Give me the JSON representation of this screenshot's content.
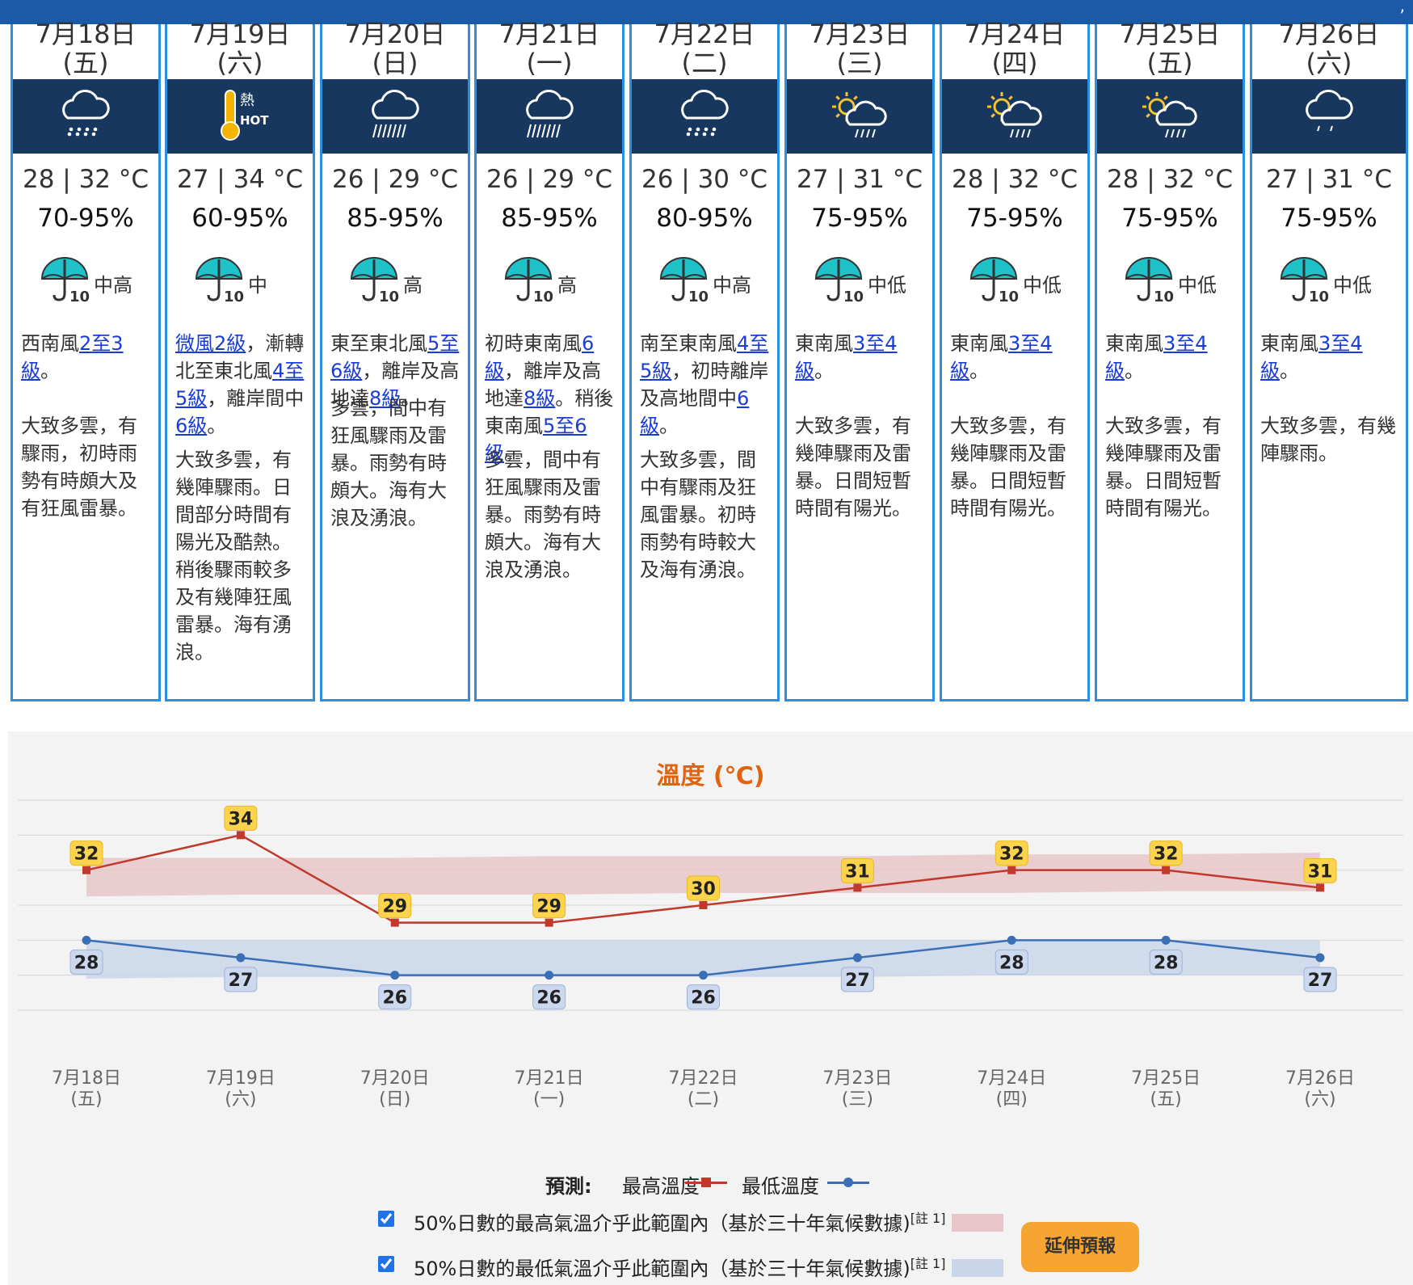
{
  "days": [
    {
      "date": "7月18日",
      "weekday": "(五)",
      "temp": "28 | 32 °C",
      "rh": "70-95%",
      "psr": "中高",
      "weather": "rain",
      "wind": [
        "西南風",
        "2至3級",
        "。"
      ],
      "desc": "大致多雲，有驟雨，初時雨勢有時頗大及有狂風雷暴。"
    },
    {
      "date": "7月19日",
      "weekday": "(六)",
      "temp": "27 | 34 °C",
      "rh": "60-95%",
      "psr": "中",
      "weather": "hot",
      "wind": [
        "",
        "微風2級",
        "，漸轉北至東北風",
        "4至5級",
        "，離岸間中",
        "6級",
        "。"
      ],
      "desc": "大致多雲，有幾陣驟雨。日間部分時間有陽光及酷熱。稍後驟雨較多及有幾陣狂風雷暴。海有湧浪。"
    },
    {
      "date": "7月20日",
      "weekday": "(日)",
      "temp": "26 | 29 °C",
      "rh": "85-95%",
      "psr": "高",
      "weather": "heavyrain",
      "wind": [
        "東至東北風",
        "5至6級",
        "，離岸及高地達",
        "8級",
        "。"
      ],
      "desc": "多雲，間中有狂風驟雨及雷暴。雨勢有時頗大。海有大浪及湧浪。"
    },
    {
      "date": "7月21日",
      "weekday": "(一)",
      "temp": "26 | 29 °C",
      "rh": "85-95%",
      "psr": "高",
      "weather": "heavyrain",
      "wind": [
        "初時東南風",
        "6級",
        "，離岸及高地達",
        "8級",
        "。稍後東南風",
        "5至6級",
        "。"
      ],
      "desc": "多雲，間中有狂風驟雨及雷暴。雨勢有時頗大。海有大浪及湧浪。"
    },
    {
      "date": "7月22日",
      "weekday": "(二)",
      "temp": "26 | 30 °C",
      "rh": "80-95%",
      "psr": "中高",
      "weather": "rain",
      "wind": [
        "南至東南風",
        "4至5級",
        "，初時離岸及高地間中",
        "6級",
        "。"
      ],
      "desc": "大致多雲，間中有驟雨及狂風雷暴。初時雨勢有時較大及海有湧浪。"
    },
    {
      "date": "7月23日",
      "weekday": "(三)",
      "temp": "27 | 31 °C",
      "rh": "75-95%",
      "psr": "中低",
      "weather": "sunshower",
      "wind": [
        "東南風",
        "3至4級",
        "。"
      ],
      "desc": "大致多雲，有幾陣驟雨及雷暴。日間短暫時間有陽光。"
    },
    {
      "date": "7月24日",
      "weekday": "(四)",
      "temp": "28 | 32 °C",
      "rh": "75-95%",
      "psr": "中低",
      "weather": "sunshower",
      "wind": [
        "東南風",
        "3至4級",
        "。"
      ],
      "desc": "大致多雲，有幾陣驟雨及雷暴。日間短暫時間有陽光。"
    },
    {
      "date": "7月25日",
      "weekday": "(五)",
      "temp": "28 | 32 °C",
      "rh": "75-95%",
      "psr": "中低",
      "weather": "sunshower",
      "wind": [
        "東南風",
        "3至4級",
        "。"
      ],
      "desc": "大致多雲，有幾陣驟雨及雷暴。日間短暫時間有陽光。"
    },
    {
      "date": "7月26日",
      "weekday": "(六)",
      "temp": "27 | 31 °C",
      "rh": "75-95%",
      "psr": "中低",
      "weather": "showers",
      "wind": [
        "東南風",
        "3至4級",
        "。"
      ],
      "desc": "大致多雲，有幾陣驟雨。"
    }
  ],
  "hot_label": "熱",
  "hot_label_en": "HOT",
  "psr_icon_number": "10",
  "chart_data": {
    "type": "line",
    "title": "溫度 (℃)",
    "categories": [
      "7月18日\n(五)",
      "7月19日\n(六)",
      "7月20日\n(日)",
      "7月21日\n(一)",
      "7月22日\n(二)",
      "7月23日\n(三)",
      "7月24日\n(四)",
      "7月25日\n(五)",
      "7月26日\n(六)"
    ],
    "series": [
      {
        "name": "最高溫度",
        "color": "#c0392b",
        "values": [
          32,
          34,
          29,
          29,
          30,
          31,
          32,
          32,
          31
        ]
      },
      {
        "name": "最低溫度",
        "color": "#3b6fb5",
        "values": [
          28,
          27,
          26,
          26,
          26,
          27,
          28,
          28,
          27
        ]
      }
    ],
    "bands": [
      {
        "name": "50%日數的最高氣溫介乎此範圍內",
        "color": "#e8c5c8",
        "lower": [
          30.5,
          30.6,
          30.6,
          30.6,
          30.7,
          30.7,
          30.7,
          30.8,
          30.8
        ],
        "upper": [
          32.7,
          32.7,
          32.7,
          32.8,
          32.8,
          32.8,
          32.9,
          32.9,
          33.0
        ]
      },
      {
        "name": "50%日數的最低氣溫介乎此範圍內",
        "color": "#c9d6ea",
        "lower": [
          25.8,
          25.9,
          25.9,
          25.9,
          25.9,
          25.9,
          26.0,
          26.0,
          26.0
        ],
        "upper": [
          28.0,
          28.0,
          28.0,
          28.0,
          28.0,
          28.0,
          28.0,
          28.0,
          28.0
        ]
      }
    ],
    "ylim": [
      24,
      36
    ],
    "grid": true
  },
  "legend": {
    "pred_label": "預測:",
    "max_label": "最高溫度",
    "min_label": "最低溫度",
    "max_color": "#c0392b",
    "min_color": "#3b6fb5"
  },
  "band_max_text": "50%日數的最高氣溫介乎此範圍內（基於三十年氣候數據)",
  "band_min_text": "50%日數的最低氣溫介乎此範圍內（基於三十年氣候數據)",
  "note_label": "[註 1]",
  "extended_button": "延伸預報"
}
